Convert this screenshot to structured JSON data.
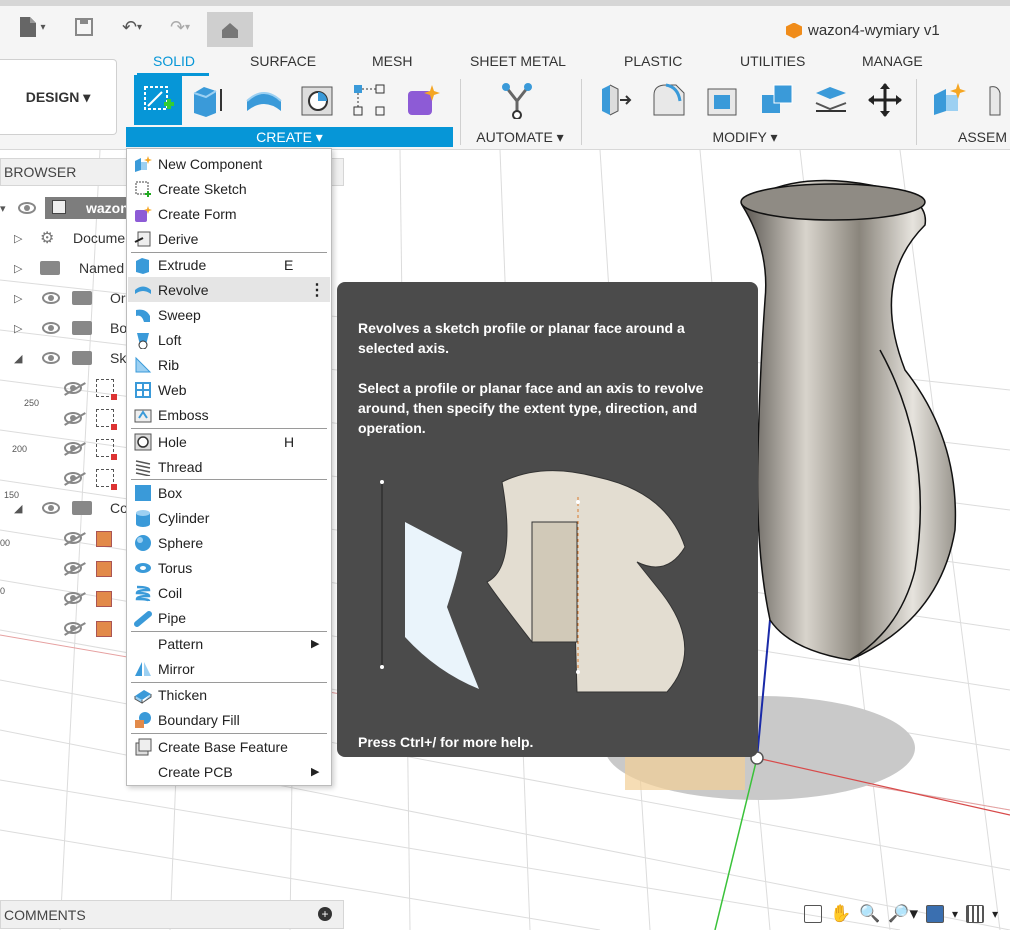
{
  "document": {
    "title": "wazon4-wymiary v1"
  },
  "workspace": {
    "design_label": "DESIGN ▾"
  },
  "tabs": [
    "SOLID",
    "SURFACE",
    "MESH",
    "SHEET METAL",
    "PLASTIC",
    "UTILITIES",
    "MANAGE"
  ],
  "groups": {
    "create": "CREATE ▾",
    "automate": "AUTOMATE ▾",
    "modify": "MODIFY ▾",
    "assemble": "ASSEM"
  },
  "browser": {
    "title": "BROWSER",
    "nodes": [
      "wazon",
      "Docume",
      "Named",
      "Or",
      "Bo",
      "Sk",
      "Co"
    ]
  },
  "grid_labels": [
    "250",
    "200",
    "150",
    "00",
    "0"
  ],
  "create_menu": {
    "items": [
      {
        "label": "New Component",
        "shortcut": ""
      },
      {
        "label": "Create Sketch",
        "shortcut": ""
      },
      {
        "label": "Create Form",
        "shortcut": ""
      },
      {
        "label": "Derive",
        "shortcut": ""
      },
      {
        "label": "Extrude",
        "shortcut": "E"
      },
      {
        "label": "Revolve",
        "shortcut": ""
      },
      {
        "label": "Sweep",
        "shortcut": ""
      },
      {
        "label": "Loft",
        "shortcut": ""
      },
      {
        "label": "Rib",
        "shortcut": ""
      },
      {
        "label": "Web",
        "shortcut": ""
      },
      {
        "label": "Emboss",
        "shortcut": ""
      },
      {
        "label": "Hole",
        "shortcut": "H"
      },
      {
        "label": "Thread",
        "shortcut": ""
      },
      {
        "label": "Box",
        "shortcut": ""
      },
      {
        "label": "Cylinder",
        "shortcut": ""
      },
      {
        "label": "Sphere",
        "shortcut": ""
      },
      {
        "label": "Torus",
        "shortcut": ""
      },
      {
        "label": "Coil",
        "shortcut": ""
      },
      {
        "label": "Pipe",
        "shortcut": ""
      },
      {
        "label": "Pattern",
        "shortcut": ""
      },
      {
        "label": "Mirror",
        "shortcut": ""
      },
      {
        "label": "Thicken",
        "shortcut": ""
      },
      {
        "label": "Boundary Fill",
        "shortcut": ""
      },
      {
        "label": "Create Base Feature",
        "shortcut": ""
      },
      {
        "label": "Create PCB",
        "shortcut": ""
      }
    ]
  },
  "tooltip": {
    "summary": "Revolves a sketch profile or planar face around a selected axis.",
    "details": "Select a profile or planar face and an axis to revolve around, then specify the extent type, direction, and operation.",
    "help": "Press Ctrl+/ for more help."
  },
  "comments": {
    "title": "COMMENTS"
  },
  "colors": {
    "accent": "#0696d7",
    "tooltip_bg": "#4b4b4b",
    "menu_highlight": "#e5e5e5"
  }
}
